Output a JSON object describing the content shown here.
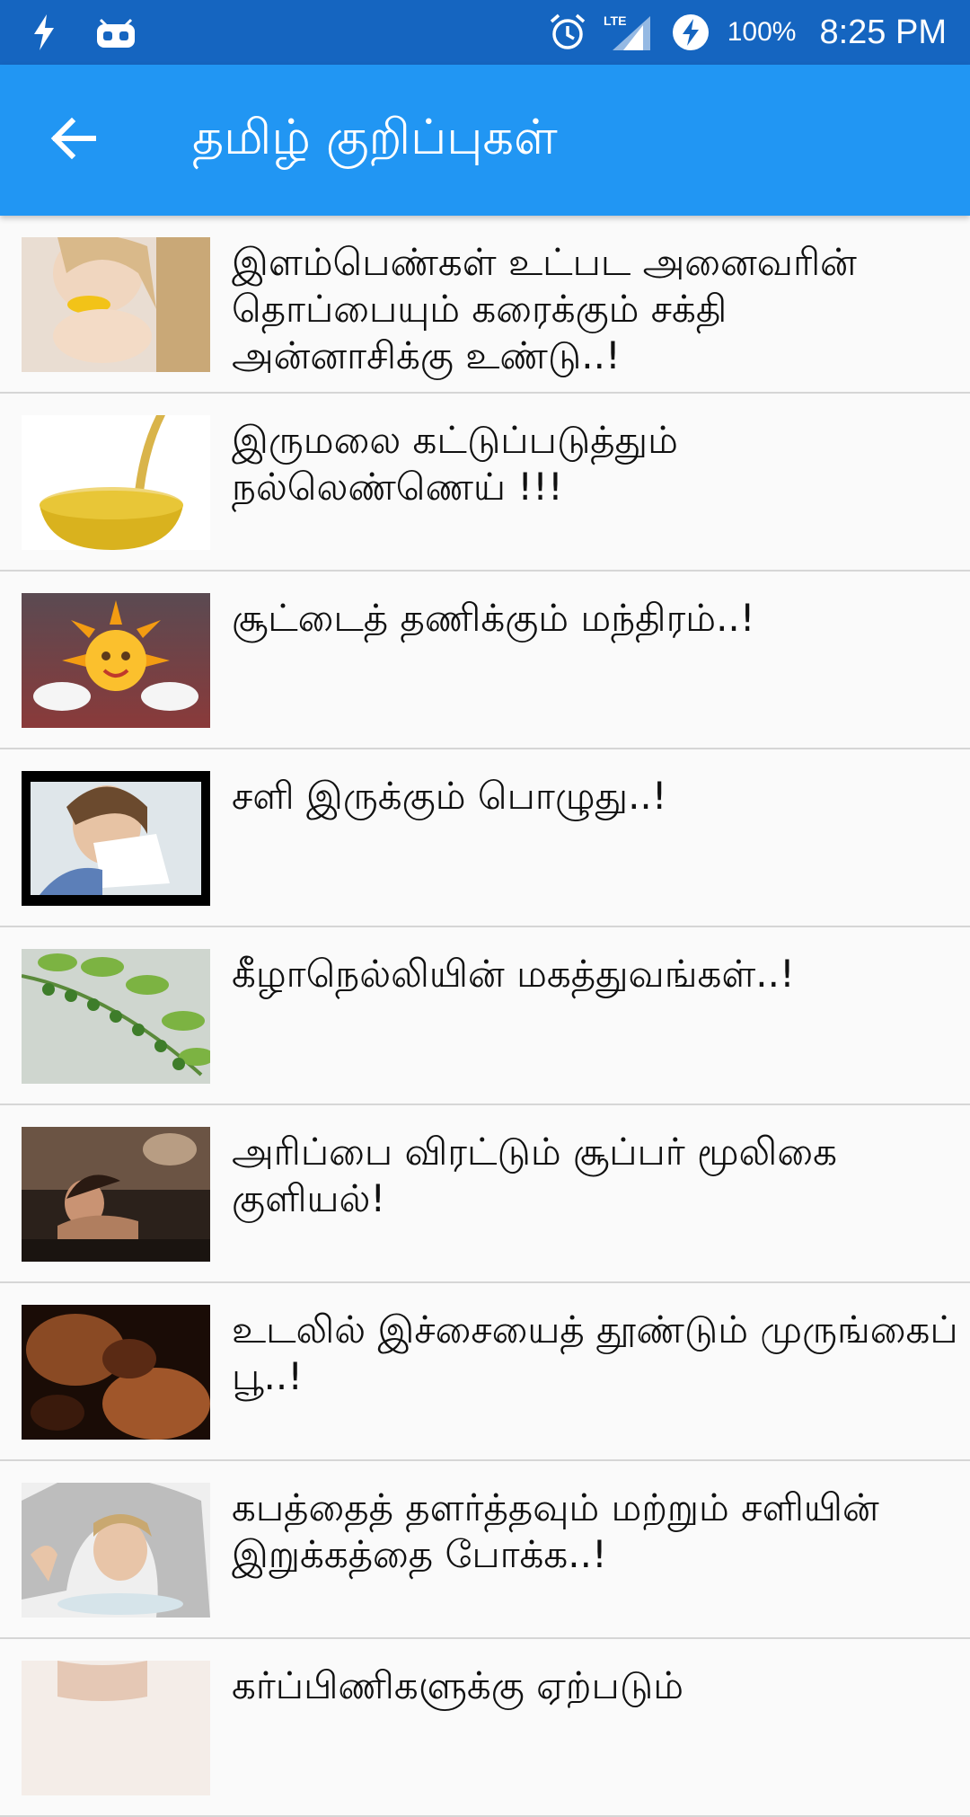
{
  "status_bar": {
    "battery": "100%",
    "time": "8:25 PM",
    "network": "LTE",
    "icons": [
      "flash-icon",
      "android-icon",
      "alarm-icon",
      "lte-signal-icon",
      "battery-charging-icon"
    ]
  },
  "app_bar": {
    "title": "தமிழ் குறிப்புகள்",
    "back_icon": "arrow-back-icon",
    "color": "#2196f3"
  },
  "list": {
    "items": [
      {
        "title": "இளம்பெண்கள் உட்பட அனைவரின் தொப்பையும் கரைக்கும் சக்தி அன்னாசிக்கு உண்டு..!",
        "thumb": "woman-eating-fruit"
      },
      {
        "title": "இருமலை கட்டுப்படுத்தும் நல்லெண்ணெய் !!!",
        "thumb": "oil-pouring-bowl"
      },
      {
        "title": "சூட்டைத் தணிக்கும் மந்திரம்..!",
        "thumb": "cartoon-sun"
      },
      {
        "title": "சளி இருக்கும் பொழுது..!",
        "thumb": "woman-with-tissue"
      },
      {
        "title": "கீழாநெல்லியின் மகத்துவங்கள்..!",
        "thumb": "green-leaf-berries"
      },
      {
        "title": "அரிப்பை விரட்டும் சூப்பர் மூலிகை குளியல்!",
        "thumb": "woman-bathing"
      },
      {
        "title": "உடலில் இச்சையைத் தூண்டும் முருங்கைப் பூ..!",
        "thumb": "couple-dark"
      },
      {
        "title": "கபத்தைத் தளர்த்தவும் மற்றும் சளியின் இறுக்கத்தை போக்க..!",
        "thumb": "woman-steam-inhalation"
      },
      {
        "title": "கர்ப்பிணிகளுக்கு ஏற்படும்",
        "thumb": "pregnant-woman"
      }
    ]
  }
}
